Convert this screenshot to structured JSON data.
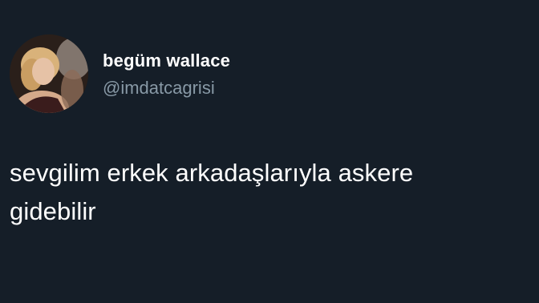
{
  "tweet": {
    "author": {
      "display_name": "begüm wallace",
      "handle": "@imdatcagrisi"
    },
    "text_line1": "sevgilim erkek arkadaşlarıyla askere",
    "text_line2": "gidebilir"
  },
  "colors": {
    "background": "#151e28",
    "primary_text": "#ffffff",
    "secondary_text": "#8899a6"
  }
}
